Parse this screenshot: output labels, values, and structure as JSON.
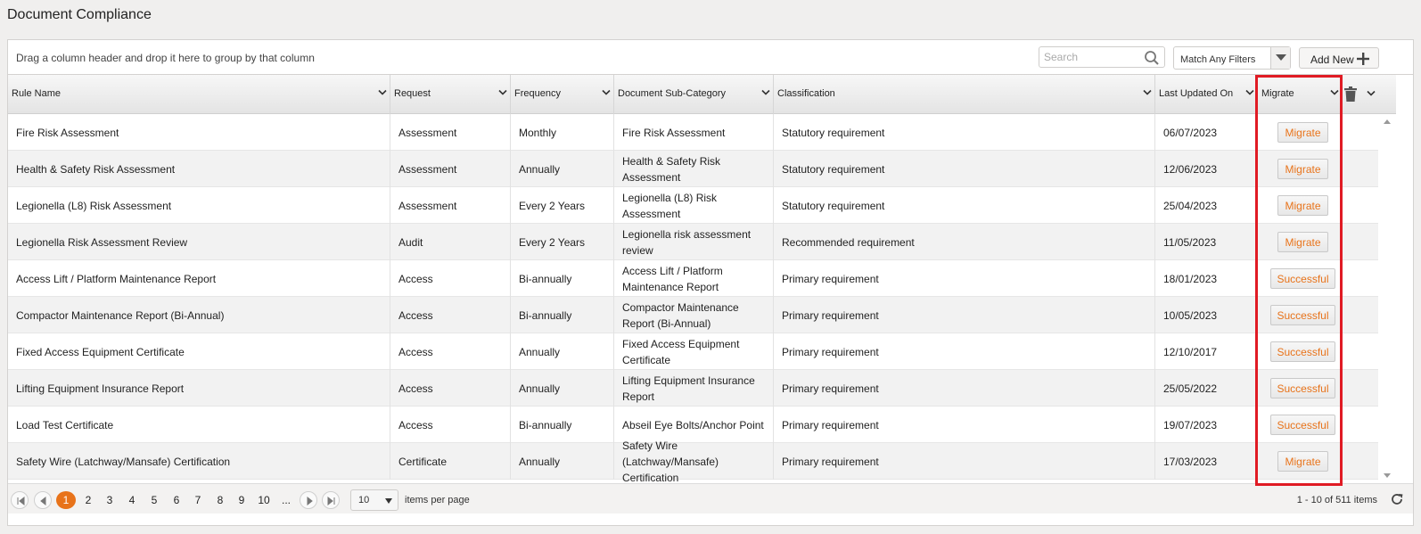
{
  "page": {
    "title": "Document Compliance"
  },
  "toolbar": {
    "group_hint": "Drag a column header and drop it here to group by that column",
    "search_placeholder": "Search",
    "filter_value": "Match Any Filters",
    "add_new_label": "Add New"
  },
  "columns": [
    {
      "label": "Rule Name"
    },
    {
      "label": "Request"
    },
    {
      "label": "Frequency"
    },
    {
      "label": "Document Sub-Category"
    },
    {
      "label": "Classification"
    },
    {
      "label": "Last Updated On"
    },
    {
      "label": "Migrate"
    }
  ],
  "rows": [
    {
      "rule": "Fire Risk Assessment",
      "request": "Assessment",
      "frequency": "Monthly",
      "subcategory": "Fire Risk Assessment",
      "classification": "Statutory requirement",
      "updated": "06/07/2023",
      "migrate": "Migrate"
    },
    {
      "rule": "Health & Safety Risk Assessment",
      "request": "Assessment",
      "frequency": "Annually",
      "subcategory": "Health & Safety Risk Assessment",
      "classification": "Statutory requirement",
      "updated": "12/06/2023",
      "migrate": "Migrate"
    },
    {
      "rule": "Legionella (L8) Risk Assessment",
      "request": "Assessment",
      "frequency": "Every 2 Years",
      "subcategory": "Legionella (L8) Risk Assessment",
      "classification": "Statutory requirement",
      "updated": "25/04/2023",
      "migrate": "Migrate"
    },
    {
      "rule": "Legionella Risk Assessment Review",
      "request": "Audit",
      "frequency": "Every 2 Years",
      "subcategory": "Legionella risk assessment review",
      "classification": "Recommended requirement",
      "updated": "11/05/2023",
      "migrate": "Migrate"
    },
    {
      "rule": "Access Lift / Platform Maintenance Report",
      "request": "Access",
      "frequency": "Bi-annually",
      "subcategory": "Access Lift / Platform Maintenance Report",
      "classification": "Primary requirement",
      "updated": "18/01/2023",
      "migrate": "Successful"
    },
    {
      "rule": "Compactor Maintenance Report (Bi-Annual)",
      "request": "Access",
      "frequency": "Bi-annually",
      "subcategory": "Compactor Maintenance Report (Bi-Annual)",
      "classification": "Primary requirement",
      "updated": "10/05/2023",
      "migrate": "Successful"
    },
    {
      "rule": "Fixed Access Equipment Certificate",
      "request": "Access",
      "frequency": "Annually",
      "subcategory": "Fixed Access Equipment Certificate",
      "classification": "Primary requirement",
      "updated": "12/10/2017",
      "migrate": "Successful"
    },
    {
      "rule": "Lifting Equipment Insurance Report",
      "request": "Access",
      "frequency": "Annually",
      "subcategory": "Lifting Equipment Insurance Report",
      "classification": "Primary requirement",
      "updated": "25/05/2022",
      "migrate": "Successful"
    },
    {
      "rule": "Load Test Certificate",
      "request": "Access",
      "frequency": "Bi-annually",
      "subcategory": "Abseil Eye Bolts/Anchor Point",
      "classification": "Primary requirement",
      "updated": "19/07/2023",
      "migrate": "Successful"
    },
    {
      "rule": "Safety Wire (Latchway/Mansafe) Certification",
      "request": "Certificate",
      "frequency": "Annually",
      "subcategory": "Safety Wire (Latchway/Mansafe) Certification",
      "classification": "Primary requirement",
      "updated": "17/03/2023",
      "migrate": "Migrate"
    }
  ],
  "pager": {
    "pages": [
      "1",
      "2",
      "3",
      "4",
      "5",
      "6",
      "7",
      "8",
      "9",
      "10",
      "..."
    ],
    "current_page": "1",
    "per_page": "10",
    "per_page_label": "items per page",
    "range_label": "1 - 10 of 511 items"
  },
  "colors": {
    "accent": "#e8731a",
    "highlight": "#e01b24"
  }
}
